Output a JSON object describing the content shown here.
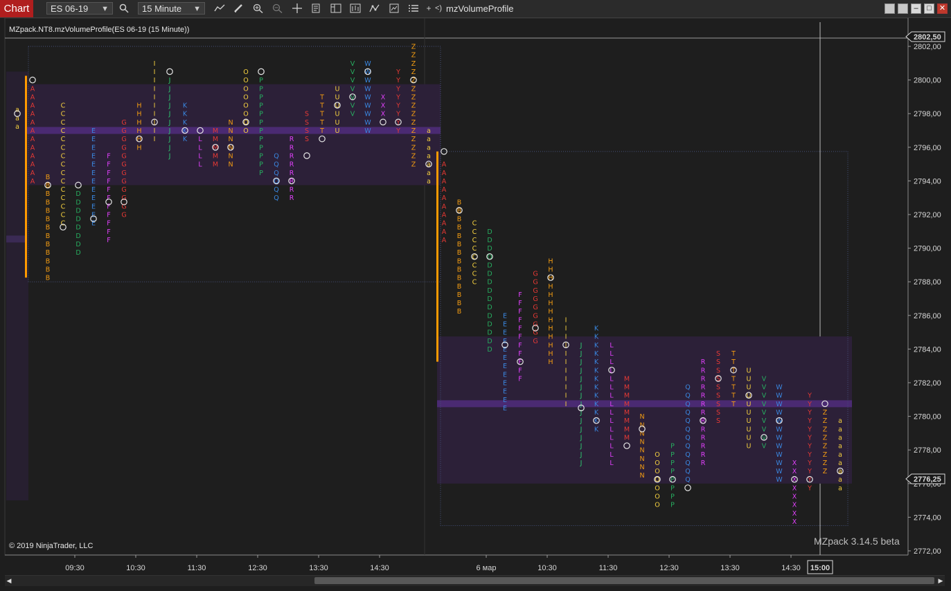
{
  "toolbar": {
    "chart_label": "Chart",
    "instrument": "ES 06-19",
    "interval": "15 Minute",
    "indicator_name": "mzVolumeProfile",
    "icons": [
      "search-icon",
      "line-chart-icon",
      "pencil-icon",
      "zoom-in-icon",
      "zoom-out-icon",
      "crosshair-icon",
      "properties-icon",
      "data-box-icon",
      "bar-chart-icon",
      "strategy-icon",
      "share-icon",
      "list-icon",
      "plus-icon",
      "back-icon"
    ],
    "plus_label": "+",
    "back_label": "<)"
  },
  "chart": {
    "title": "MZpack.NT8.mzVolumeProfile(ES 06-19 (15 Minute))",
    "copyright": "© 2019 NinjaTrader, LLC",
    "watermark": "MZpack 3.14.5 beta",
    "price_axis": [
      "2802,00",
      "2800,00",
      "2798,00",
      "2796,00",
      "2794,00",
      "2792,00",
      "2790,00",
      "2788,00",
      "2786,00",
      "2784,00",
      "2782,00",
      "2780,00",
      "2778,00",
      "2776,00",
      "2774,00",
      "2772,00"
    ],
    "price_tags": {
      "upper": "2802,50",
      "current": "2776,25"
    },
    "time_axis": [
      "09:30",
      "10:30",
      "11:30",
      "12:30",
      "13:30",
      "14:30",
      "6 мар",
      "10:30",
      "11:30",
      "12:30",
      "13:30",
      "14:30"
    ],
    "time_marker": "15:00",
    "colors": {
      "background": "#1e1e1e",
      "value_area": "#2c2038",
      "poc_band": "#4a2a72",
      "session_bar": "#ff9a00",
      "A": "#e53935",
      "B": "#f39c12",
      "C": "#f4d03f",
      "D": "#27ae60",
      "E": "#3a87e0",
      "F": "#e040fb",
      "G": "#e53935",
      "H": "#f39c12",
      "I": "#f4d03f",
      "J": "#2ecc71",
      "K": "#3a87e0",
      "L": "#e040fb",
      "M": "#e53935",
      "N": "#f39c12",
      "O": "#f4d03f",
      "P": "#27ae60",
      "Q": "#3a87e0",
      "R": "#e040fb",
      "S": "#e53935",
      "T": "#f39c12",
      "U": "#f4d03f",
      "V": "#27ae60",
      "W": "#3a87e0",
      "X": "#e040fb",
      "Y": "#e53935",
      "Z": "#f39c12",
      "a": "#f4d03f"
    }
  },
  "sessions": [
    {
      "periods": [
        {
          "l": "a",
          "hi": 2798.25,
          "lo": 2797.0,
          "mark": 2798.0
        },
        {
          "l": "A",
          "hi": 2799.5,
          "lo": 2793.75,
          "mark": 2800.0
        },
        {
          "l": "B",
          "hi": 2794.25,
          "lo": 2788.25,
          "mark": 2793.75
        },
        {
          "l": "C",
          "hi": 2798.5,
          "lo": 2791.5,
          "mark": 2791.25
        },
        {
          "l": "D",
          "hi": 2793.25,
          "lo": 2789.75,
          "mark": 2793.75
        },
        {
          "l": "E",
          "hi": 2797.0,
          "lo": 2791.25,
          "mark": 2791.75
        },
        {
          "l": "F",
          "hi": 2795.5,
          "lo": 2790.25,
          "mark": 2792.75
        },
        {
          "l": "G",
          "hi": 2797.5,
          "lo": 2791.75,
          "mark": 2792.75
        },
        {
          "l": "H",
          "hi": 2798.5,
          "lo": 2796.0,
          "mark": 2796.5
        },
        {
          "l": "I",
          "hi": 2801.0,
          "lo": 2796.5,
          "mark": 2797.5
        },
        {
          "l": "J",
          "hi": 2800.0,
          "lo": 2795.5,
          "mark": 2800.5
        },
        {
          "l": "K",
          "hi": 2798.5,
          "lo": 2796.5,
          "mark": 2797.0
        },
        {
          "l": "L",
          "hi": 2796.5,
          "lo": 2795.0,
          "mark": 2797.0
        },
        {
          "l": "M",
          "hi": 2797.0,
          "lo": 2795.0,
          "mark": 2796.0
        },
        {
          "l": "N",
          "hi": 2797.5,
          "lo": 2795.0,
          "mark": 2796.0
        },
        {
          "l": "O",
          "hi": 2800.5,
          "lo": 2797.0,
          "mark": 2797.5
        },
        {
          "l": "P",
          "hi": 2800.0,
          "lo": 2794.5,
          "mark": 2800.5
        },
        {
          "l": "Q",
          "hi": 2795.5,
          "lo": 2793.0,
          "mark": 2794.0
        },
        {
          "l": "R",
          "hi": 2796.5,
          "lo": 2793.0,
          "mark": 2794.0
        },
        {
          "l": "S",
          "hi": 2798.0,
          "lo": 2796.5,
          "mark": 2795.5
        },
        {
          "l": "T",
          "hi": 2799.0,
          "lo": 2797.0,
          "mark": 2796.5
        },
        {
          "l": "U",
          "hi": 2799.5,
          "lo": 2797.0,
          "mark": 2798.5
        },
        {
          "l": "V",
          "hi": 2801.0,
          "lo": 2798.0,
          "mark": 2799.0
        },
        {
          "l": "W",
          "hi": 2801.0,
          "lo": 2797.0,
          "mark": 2800.5
        },
        {
          "l": "X",
          "hi": 2799.0,
          "lo": 2798.0,
          "mark": 2797.5
        },
        {
          "l": "Y",
          "hi": 2800.5,
          "lo": 2797.0,
          "mark": 2797.5
        },
        {
          "l": "Z",
          "hi": 2802.0,
          "lo": 2795.0,
          "mark": 2800.0
        },
        {
          "l": "a",
          "hi": 2797.0,
          "lo": 2794.0,
          "mark": 2795.0
        }
      ]
    },
    {
      "periods": [
        {
          "l": "A",
          "hi": 2795.0,
          "lo": 2790.5,
          "mark": 2795.75
        },
        {
          "l": "B",
          "hi": 2792.75,
          "lo": 2786.0,
          "mark": 2792.25
        },
        {
          "l": "C",
          "hi": 2791.5,
          "lo": 2787.75,
          "mark": 2789.5
        },
        {
          "l": "D",
          "hi": 2791.0,
          "lo": 2783.75,
          "mark": 2789.5
        },
        {
          "l": "E",
          "hi": 2786.0,
          "lo": 2780.5,
          "mark": 2784.25
        },
        {
          "l": "F",
          "hi": 2787.25,
          "lo": 2782.25,
          "mark": 2783.25
        },
        {
          "l": "G",
          "hi": 2788.5,
          "lo": 2784.25,
          "mark": 2785.25
        },
        {
          "l": "H",
          "hi": 2789.25,
          "lo": 2783.25,
          "mark": 2788.25
        },
        {
          "l": "I",
          "hi": 2785.75,
          "lo": 2780.5,
          "mark": 2784.25
        },
        {
          "l": "J",
          "hi": 2784.25,
          "lo": 2777.25,
          "mark": 2780.5
        },
        {
          "l": "K",
          "hi": 2785.25,
          "lo": 2779.25,
          "mark": 2779.75
        },
        {
          "l": "L",
          "hi": 2784.25,
          "lo": 2777.25,
          "mark": 2782.75
        },
        {
          "l": "M",
          "hi": 2782.25,
          "lo": 2778.75,
          "mark": 2778.25
        },
        {
          "l": "N",
          "hi": 2780.0,
          "lo": 2776.25,
          "mark": 2779.25
        },
        {
          "l": "O",
          "hi": 2777.75,
          "lo": 2774.75,
          "mark": 2776.25
        },
        {
          "l": "P",
          "hi": 2778.25,
          "lo": 2774.75,
          "mark": 2776.25
        },
        {
          "l": "Q",
          "hi": 2781.75,
          "lo": 2776.25,
          "mark": 2775.75
        },
        {
          "l": "R",
          "hi": 2783.25,
          "lo": 2777.25,
          "mark": 2779.75
        },
        {
          "l": "S",
          "hi": 2783.75,
          "lo": 2779.75,
          "mark": 2782.25
        },
        {
          "l": "T",
          "hi": 2783.75,
          "lo": 2780.75,
          "mark": 2782.75
        },
        {
          "l": "U",
          "hi": 2782.75,
          "lo": 2778.25,
          "mark": 2781.25
        },
        {
          "l": "V",
          "hi": 2782.25,
          "lo": 2778.25,
          "mark": 2778.75
        },
        {
          "l": "W",
          "hi": 2781.75,
          "lo": 2776.25,
          "mark": 2779.75
        },
        {
          "l": "X",
          "hi": 2777.25,
          "lo": 2773.75,
          "mark": 2776.25
        },
        {
          "l": "Y",
          "hi": 2781.25,
          "lo": 2775.75,
          "mark": 2776.25
        },
        {
          "l": "Z",
          "hi": 2780.25,
          "lo": 2776.75,
          "mark": 2780.75
        },
        {
          "l": "a",
          "hi": 2779.75,
          "lo": 2775.75,
          "mark": 2776.75
        }
      ]
    }
  ]
}
